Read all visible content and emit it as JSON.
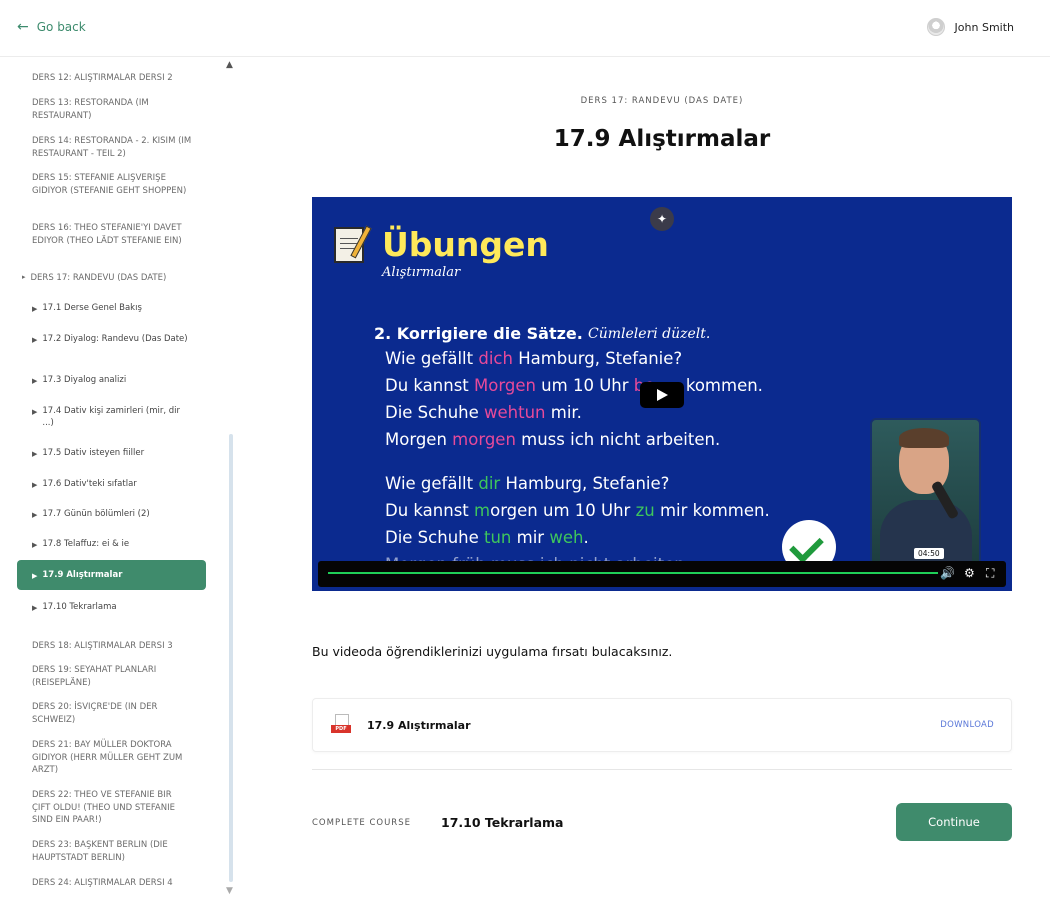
{
  "topbar": {
    "go_back": "Go back",
    "user_name": "John Smith"
  },
  "sidebar": {
    "lessons_before": [
      "DERS 12: ALIŞTIRMALAR DERSI 2",
      "DERS 13: RESTORANDA (IM RESTAURANT)",
      "DERS 14: RESTORANDA - 2. KISIM (IM RESTAURANT - TEIL 2)",
      "DERS 15: STEFANIE ALIŞVERIŞE GIDIYOR (STEFANIE GEHT SHOPPEN)",
      "DERS 16: THEO STEFANIE'YI DAVET EDIYOR (THEO LÄDT STEFANIE EIN)"
    ],
    "open_lesson": "DERS 17: RANDEVU (DAS DATE)",
    "sub_items": [
      "17.1 Derse Genel Bakış",
      "17.2 Diyalog: Randevu (Das Date)",
      "17.3 Diyalog analizi",
      "17.4 Dativ kişi zamirleri (mir, dir ...)",
      "17.5 Dativ isteyen fiiller",
      "17.6 Dativ'teki sıfatlar",
      "17.7 Günün bölümleri (2)",
      "17.8 Telaffuz: ei & ie",
      "17.9 Alıştırmalar",
      "17.10 Tekrarlama"
    ],
    "lessons_after": [
      "DERS 18: ALIŞTIRMALAR DERSI 3",
      "DERS 19: SEYAHAT PLANLARI (REISEPLÄNE)",
      "DERS 20: İSVIÇRE'DE (IN DER SCHWEIZ)",
      "DERS 21: BAY MÜLLER DOKTORA GIDIYOR (HERR MÜLLER GEHT ZUM ARZT)",
      "DERS 22: THEO VE STEFANIE BIR ÇIFT OLDU! (THEO UND STEFANIE SIND EIN PAAR!)",
      "DERS 23: BAŞKENT BERLIN (DIE HAUPTSTADT BERLIN)",
      "DERS 24: ALIŞTIRMALAR DERSI 4"
    ]
  },
  "main": {
    "kicker": "DERS 17: RANDEVU (DAS DATE)",
    "title": "17.9 Alıştırmalar",
    "description": "Bu videoda öğrendiklerinizi uygulama fırsatı bulacaksınız.",
    "file_name": "17.9 Alıştırmalar",
    "download": "DOWNLOAD",
    "pdf_tag": "PDF",
    "complete_label": "COMPLETE COURSE",
    "next_lesson": "17.10 Tekrarlama",
    "continue": "Continue"
  },
  "video": {
    "heading": "Übungen",
    "subheading": "Alıştırmalar",
    "task": "2. Korrigiere die Sätze.",
    "task_tr": "Cümleleri düzelt.",
    "l1a": "Wie gefällt ",
    "l1b": "dich",
    "l1c": " Hamburg, Stefanie?",
    "l2a": "Du kannst ",
    "l2b": "Morgen",
    "l2c": " um 10 Uhr ",
    "l2d": "be",
    "l2e": "      kommen.",
    "l3a": "Die Schuhe ",
    "l3b": "wehtun",
    "l3c": " mir.",
    "l4a": "Morgen ",
    "l4b": "morgen",
    "l4c": " muss ich nicht arbeiten.",
    "l5a": "Wie gefällt ",
    "l5b": "dir",
    "l5c": " Hamburg, Stefanie?",
    "l6a": "Du kannst ",
    "l6b": "m",
    "l6c": "orgen um 10 Uhr ",
    "l6d": "zu",
    "l6e": " mir kommen.",
    "l7a": "Die Schuhe ",
    "l7b": "tun",
    "l7c": " mir ",
    "l7d": "weh",
    "l7e": ".",
    "l8": "Morgen früh muss ich nicht arbeiten.",
    "time": "04:50",
    "progress": 0.89
  }
}
